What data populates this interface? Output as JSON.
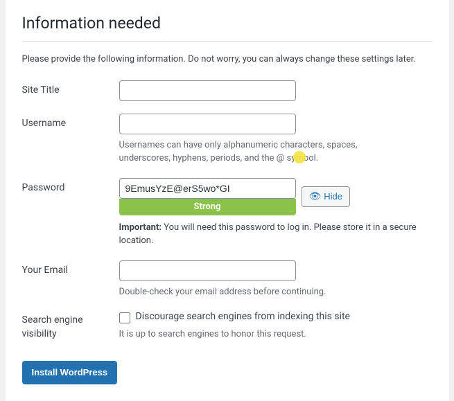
{
  "page": {
    "title": "Information needed",
    "divider": true,
    "description": "Please provide the following information. Do not worry, you can always change these settings later."
  },
  "form": {
    "site_title": {
      "label": "Site Title",
      "value": "",
      "placeholder": ""
    },
    "username": {
      "label": "Username",
      "value": "",
      "placeholder": "",
      "hint": "Usernames can have only alphanumeric characters, spaces, underscores, hyphens, periods, and the @ symbol."
    },
    "password": {
      "label": "Password",
      "value": "9EmusYzE@erS5wo*GI",
      "strength": "Strong",
      "strength_color": "#8bc34a",
      "hide_button_label": "Hide",
      "important_text": "Important:",
      "important_note": " You will need this password to log in. Please store it in a secure location."
    },
    "email": {
      "label": "Your Email",
      "value": "",
      "placeholder": "",
      "hint": "Double-check your email address before continuing."
    },
    "search_visibility": {
      "label": "Search engine visibility",
      "checkbox_label": "Discourage search engines from indexing this site",
      "checked": false,
      "hint": "It is up to search engines to honor this request."
    }
  },
  "buttons": {
    "install": "Install WordPress"
  },
  "icons": {
    "eye": "👁"
  }
}
